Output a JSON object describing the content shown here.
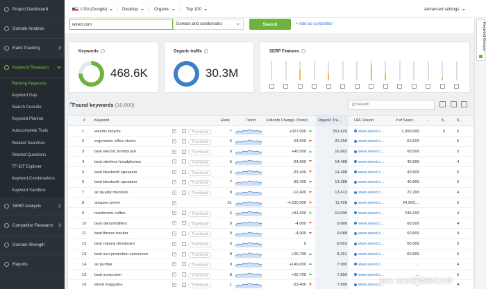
{
  "sidebar": {
    "items": [
      {
        "label": "Project Dashboard"
      },
      {
        "label": "Domain Analysis"
      },
      {
        "label": "Rank Tracking"
      },
      {
        "label": "Keyword Research"
      }
    ],
    "sub_items": [
      {
        "label": "Ranking Keywords"
      },
      {
        "label": "Keyword Gap"
      },
      {
        "label": "Search Console"
      },
      {
        "label": "Keyword Planner"
      },
      {
        "label": "Autocomplete Tools"
      },
      {
        "label": "Related Searches"
      },
      {
        "label": "Related Questions"
      },
      {
        "label": "TF-IDF Explorer"
      },
      {
        "label": "Keyword Combinations"
      },
      {
        "label": "Keyword Sandbox"
      }
    ],
    "bottom_items": [
      {
        "label": "SERP Analysis"
      },
      {
        "label": "Competitor Research"
      },
      {
        "label": "Domain Strength"
      },
      {
        "label": "Reports"
      }
    ]
  },
  "topbar": {
    "country": "USA (Google)",
    "device": "Desktop",
    "type": "Organic",
    "top": "Top 100",
    "advanced": "Advanced settings"
  },
  "search": {
    "domain_value": "wired.com",
    "scope": "Domain and subdomains",
    "button": "Search",
    "add_competitor": "+ Add as competitor"
  },
  "right_tab": {
    "label": "Keyword Groups"
  },
  "cards": {
    "keywords": {
      "title": "Keywords",
      "value": "468.6K",
      "fraction": 0.75,
      "color": "#6db33f"
    },
    "traffic": {
      "title": "Organic traffic",
      "value": "30.3M",
      "fraction": 1.0,
      "color": "#3f7fc8"
    },
    "serp": {
      "title": "SERP Features",
      "fills": [
        0,
        0,
        0.55,
        0,
        0.35,
        0,
        0,
        0.8,
        0.4,
        0,
        0,
        0,
        0.15,
        0
      ]
    }
  },
  "found": {
    "title": "Found keywords",
    "count": "(10,000)",
    "filter_placeholder": "Search"
  },
  "table": {
    "headers": [
      "#",
      "Keyword",
      "Rank",
      "Trend",
      "3-Month Change (Trend)",
      "Organic Tra...",
      "URL Found",
      "# of Searc...",
      "...",
      "K...",
      "K..."
    ],
    "thumb_label": "Thumbnail",
    "rows": [
      {
        "n": "1",
        "kw": "electric bicycle",
        "thumb": true,
        "rank": "7",
        "chg": "+327,000",
        "dir": "up",
        "traffic": "351,620",
        "url": "www.wired.c...",
        "searches": "1,000,000",
        "k1": "6",
        "k2": "5"
      },
      {
        "n": "2",
        "kw": "ergonomic office chairs",
        "thumb": true,
        "rank": "6",
        "chg": "-24,500",
        "dir": "down",
        "traffic": "20,258",
        "url": "www.wired.c...",
        "searches": "60,500",
        "k1": "",
        "k2": "5"
      },
      {
        "n": "3",
        "kw": "best electric toothbrush",
        "thumb": true,
        "rank": "6",
        "chg": "+49,500",
        "dir": "up",
        "traffic": "16,662",
        "url": "www.wired.c...",
        "searches": "60,500",
        "k1": "",
        "k2": "5"
      },
      {
        "n": "4",
        "kw": "best wireless headphones",
        "thumb": true,
        "rank": "5",
        "chg": "-24,500",
        "dir": "down",
        "traffic": "14,488",
        "url": "www.wired.c...",
        "searches": "49,500",
        "k1": "",
        "k2": "4"
      },
      {
        "n": "5",
        "kw": "best bluetooth speakers",
        "thumb": true,
        "rank": "6",
        "chg": "-33,400",
        "dir": "down",
        "traffic": "14,488",
        "url": "www.wired.c...",
        "searches": "40,500",
        "k1": "",
        "k2": "5"
      },
      {
        "n": "6",
        "kw": "best bluetooth speakers",
        "thumb": true,
        "rank": "7",
        "chg": "-33,400",
        "dir": "down",
        "traffic": "13,288",
        "url": "www.wired.c...",
        "searches": "40,500",
        "k1": "",
        "k2": "5"
      },
      {
        "n": "7",
        "kw": "air quality monitors",
        "thumb": true,
        "rank": "8",
        "chg": "-12,400",
        "dir": "down",
        "traffic": "13,413",
        "url": "www.wired.c...",
        "searches": "22,200",
        "k1": "",
        "k2": "4"
      },
      {
        "n": "8",
        "kw": "amazon prime",
        "thumb": false,
        "rank": "31",
        "chg": "-4,500,000",
        "dir": "down",
        "traffic": "11,428",
        "url": "www.wired.c...",
        "searches": "24,900,...",
        "k1": "",
        "k2": "5"
      },
      {
        "n": "9",
        "kw": "mushroom coffee",
        "thumb": true,
        "rank": "6",
        "chg": "+81,000",
        "dir": "up",
        "traffic": "10,006",
        "url": "www.wired.c...",
        "searches": "246,000",
        "k1": "",
        "k2": "4"
      },
      {
        "n": "10",
        "kw": "best dehumidifiers",
        "thumb": true,
        "rank": "9",
        "chg": "-4,000",
        "dir": "down",
        "traffic": "9,688",
        "url": "www.wired.c...",
        "searches": "60,500",
        "k1": "",
        "k2": "4"
      },
      {
        "n": "11",
        "kw": "best fitness tracker",
        "thumb": true,
        "rank": "9",
        "chg": "-4,000",
        "dir": "down",
        "traffic": "9,688",
        "url": "www.wired.c...",
        "searches": "60,500",
        "k1": "",
        "k2": "4"
      },
      {
        "n": "12",
        "kw": "best natural deodorant",
        "thumb": true,
        "rank": "6",
        "chg": "0",
        "dir": "flat",
        "traffic": "8,653",
        "url": "www.wired.c...",
        "searches": "60,500",
        "k1": "",
        "k2": "5"
      },
      {
        "n": "13",
        "kw": "best sun protection sunscreen",
        "thumb": true,
        "rank": "8",
        "chg": "+25,700",
        "dir": "up",
        "traffic": "8,261",
        "url": "www.wired.c...",
        "searches": "60,500",
        "k1": "",
        "k2": "5"
      },
      {
        "n": "14",
        "kw": "air purifier",
        "thumb": true,
        "rank": "9",
        "chg": "+149,000",
        "dir": "up",
        "traffic": "7,990",
        "url": "www.wired.c...",
        "searches": "...",
        "k1": "",
        "k2": "4"
      },
      {
        "n": "15",
        "kw": "best sunscreen",
        "thumb": true,
        "rank": "8",
        "chg": "+25,700",
        "dir": "up",
        "traffic": "7,890",
        "url": "www.wired.c...",
        "searches": "...",
        "k1": "",
        "k2": "5"
      },
      {
        "n": "16",
        "kw": "wired magazine",
        "thumb": true,
        "rank": "1",
        "chg": "-33,400",
        "dir": "down",
        "traffic": "7,890",
        "url": "www.wired.c...",
        "searches": "...",
        "k1": "",
        "k2": "4"
      }
    ]
  },
  "watermark": "SEO SEM营销顾问大师"
}
